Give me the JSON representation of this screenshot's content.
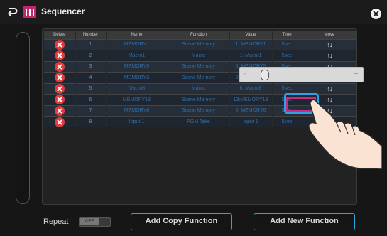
{
  "app": {
    "title": "Sequencer",
    "icon": "sequencer-app-icon",
    "brand_color": "#c2266f"
  },
  "table": {
    "columns": [
      "Delete",
      "Number",
      "Name",
      "Function",
      "Value",
      "Time",
      "Move"
    ],
    "rows": [
      {
        "number": "1",
        "name": "MEMORY1",
        "function": "Scene Memory",
        "value": "1: MEMORY1",
        "time": "5sec"
      },
      {
        "number": "2",
        "name": "Macro1",
        "function": "Macro",
        "value": "1: Macro1",
        "time": "5sec"
      },
      {
        "number": "3",
        "name": "MEMORY5",
        "function": "Scene Memory",
        "value": "5: MEMORY5",
        "time": "5sec"
      },
      {
        "number": "4",
        "name": "MEMORY3",
        "function": "Scene Memory",
        "value": "3: MEMORY3",
        "time": "5sec"
      },
      {
        "number": "5",
        "name": "Macro8",
        "function": "Macro",
        "value": "8: Macro8",
        "time": "5sec"
      },
      {
        "number": "6",
        "name": "MEMORY13",
        "function": "Scene Memory",
        "value": "13:MEMORY13",
        "time": "5sec"
      },
      {
        "number": "7",
        "name": "MEMORY6",
        "function": "Scene Memory",
        "value": "6: MEMORY6",
        "time": "5sec"
      },
      {
        "number": "8",
        "name": "Input 1",
        "function": "PGM Take",
        "value": "Input 1",
        "time": "5sec"
      }
    ],
    "move_glyph": "↑↓",
    "selected_row": 5,
    "selected_column": "Time"
  },
  "time_slider": {
    "minus": "-",
    "plus": "+",
    "level": 0.1
  },
  "footer": {
    "repeat_label": "Repeat",
    "repeat_toggle": "OFF",
    "add_copy": "Add Copy Function",
    "add_new": "Add New Function"
  },
  "colors": {
    "accent": "#2aa3e0",
    "delete": "#e23b3b",
    "selection": "#c62c86"
  }
}
